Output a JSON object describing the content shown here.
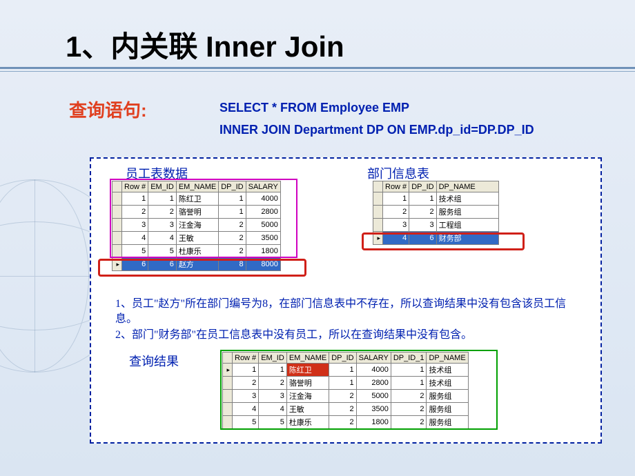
{
  "title": "1、内关联 Inner Join",
  "queryLabel": "查询语句:",
  "sql": {
    "line1": "SELECT * FROM Employee EMP",
    "line2": "INNER JOIN Department DP ON EMP.dp_id=DP.DP_ID"
  },
  "empTitle": "员工表数据",
  "depTitle": "部门信息表",
  "resultTitle": "查询结果",
  "notes": {
    "n1": "1、员工\"赵方\"所在部门编号为8，在部门信息表中不存在，所以查询结果中没有包含该员工信息。",
    "n2": "2、部门\"财务部\"在员工信息表中没有员工，所以在查询结果中没有包含。"
  },
  "emp": {
    "headers": [
      "Row #",
      "EM_ID",
      "EM_NAME",
      "DP_ID",
      "SALARY"
    ],
    "rows": [
      {
        "rn": "1",
        "id": "1",
        "name": "陈红卫",
        "dp": "1",
        "sal": "4000"
      },
      {
        "rn": "2",
        "id": "2",
        "name": "骆誉明",
        "dp": "1",
        "sal": "2800"
      },
      {
        "rn": "3",
        "id": "3",
        "name": "汪金海",
        "dp": "2",
        "sal": "5000"
      },
      {
        "rn": "4",
        "id": "4",
        "name": "王敏",
        "dp": "2",
        "sal": "3500"
      },
      {
        "rn": "5",
        "id": "5",
        "name": "杜康乐",
        "dp": "2",
        "sal": "1800"
      },
      {
        "rn": "6",
        "id": "6",
        "name": "赵方",
        "dp": "8",
        "sal": "8000"
      }
    ]
  },
  "dep": {
    "headers": [
      "Row #",
      "DP_ID",
      "DP_NAME"
    ],
    "rows": [
      {
        "rn": "1",
        "id": "1",
        "name": "技术组"
      },
      {
        "rn": "2",
        "id": "2",
        "name": "服务组"
      },
      {
        "rn": "3",
        "id": "3",
        "name": "工程组"
      },
      {
        "rn": "4",
        "id": "6",
        "name": "财务部"
      }
    ]
  },
  "res": {
    "headers": [
      "Row #",
      "EM_ID",
      "EM_NAME",
      "DP_ID",
      "SALARY",
      "DP_ID_1",
      "DP_NAME"
    ],
    "rows": [
      {
        "rn": "1",
        "id": "1",
        "name": "陈红卫",
        "dp": "1",
        "sal": "4000",
        "dp1": "1",
        "dn": "技术组"
      },
      {
        "rn": "2",
        "id": "2",
        "name": "骆誉明",
        "dp": "1",
        "sal": "2800",
        "dp1": "1",
        "dn": "技术组"
      },
      {
        "rn": "3",
        "id": "3",
        "name": "汪金海",
        "dp": "2",
        "sal": "5000",
        "dp1": "2",
        "dn": "服务组"
      },
      {
        "rn": "4",
        "id": "4",
        "name": "王敏",
        "dp": "2",
        "sal": "3500",
        "dp1": "2",
        "dn": "服务组"
      },
      {
        "rn": "5",
        "id": "5",
        "name": "杜康乐",
        "dp": "2",
        "sal": "1800",
        "dp1": "2",
        "dn": "服务组"
      }
    ]
  }
}
